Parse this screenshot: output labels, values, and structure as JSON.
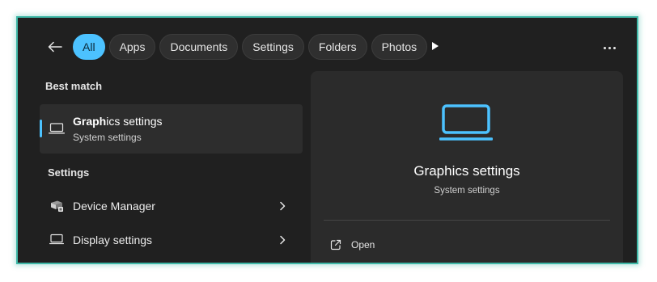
{
  "filters": {
    "back_icon": "arrow-left-icon",
    "items": [
      {
        "label": "All",
        "active": true
      },
      {
        "label": "Apps",
        "active": false
      },
      {
        "label": "Documents",
        "active": false
      },
      {
        "label": "Settings",
        "active": false
      },
      {
        "label": "Folders",
        "active": false
      },
      {
        "label": "Photos",
        "active": false
      }
    ],
    "play_icon": "play-icon",
    "more_icon": "more-horizontal-icon"
  },
  "best_match": {
    "heading": "Best match",
    "item": {
      "title_bold": "Graph",
      "title_rest": "ics settings",
      "subtitle": "System settings",
      "icon": "laptop-icon"
    }
  },
  "settings_section": {
    "heading": "Settings",
    "items": [
      {
        "label": "Device Manager",
        "icon": "device-manager-icon"
      },
      {
        "label": "Display settings",
        "icon": "monitor-icon"
      }
    ]
  },
  "preview": {
    "icon": "laptop-icon",
    "title": "Graphics settings",
    "subtitle": "System settings",
    "actions": [
      {
        "label": "Open",
        "icon": "open-external-icon"
      }
    ]
  },
  "colors": {
    "accent": "#4cc2ff",
    "panel_bg": "#202020",
    "border": "#3fb9a8"
  }
}
